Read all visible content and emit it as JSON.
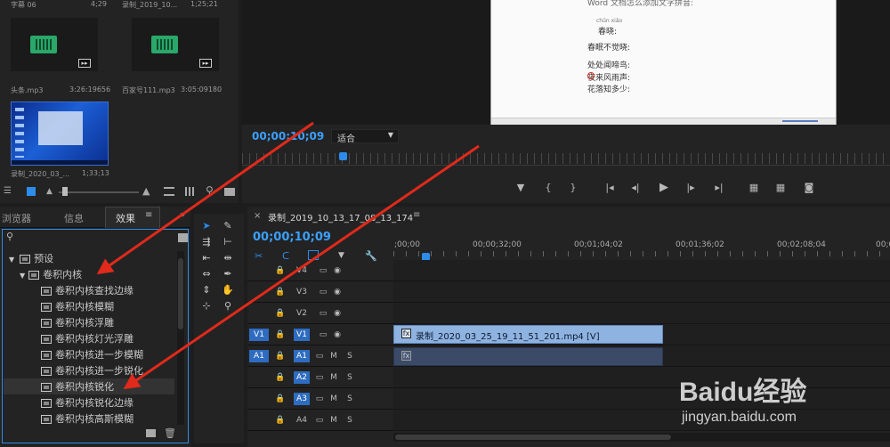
{
  "project": {
    "items": [
      {
        "name": "字幕 06",
        "duration": "4;29"
      },
      {
        "name": "录制_2019_10...",
        "duration": "1;25;21"
      },
      {
        "name": "头条.mp3",
        "duration": "3:26:19656"
      },
      {
        "name": "百家号111.mp3",
        "duration": "3:05:09180"
      },
      {
        "name": "录制_2020_03_...",
        "duration": "1;33;13"
      }
    ]
  },
  "program": {
    "doc_title": "Word 文档怎么添加文字拼音:",
    "doc_lines": [
      "chūn xiǎo",
      "春晓:",
      "春眠不觉晓:",
      "处处闻啼鸟:",
      "夜来风雨声:",
      "花落知多少:"
    ],
    "timecode": "00;00;10;09",
    "fit_label": "适合"
  },
  "panels": {
    "tabs": [
      "浏览器",
      "信息",
      "效果"
    ],
    "active_tab": "效果",
    "tree": [
      {
        "label": "预设",
        "level": 0
      },
      {
        "label": "卷积内核",
        "level": 1
      },
      {
        "label": "卷积内核查找边缘",
        "level": 2
      },
      {
        "label": "卷积内核模糊",
        "level": 2
      },
      {
        "label": "卷积内核浮雕",
        "level": 2
      },
      {
        "label": "卷积内核灯光浮雕",
        "level": 2
      },
      {
        "label": "卷积内核进一步模糊",
        "level": 2
      },
      {
        "label": "卷积内核进一步锐化",
        "level": 2
      },
      {
        "label": "卷积内核锐化",
        "level": 2
      },
      {
        "label": "卷积内核锐化边缘",
        "level": 2
      },
      {
        "label": "卷积内核高斯模糊",
        "level": 2
      }
    ]
  },
  "timeline": {
    "sequence_name": "录制_2019_10_13_17_08_13_174",
    "timecode": "00;00;10;09",
    "ruler": [
      ";00;00",
      "00;00;32;00",
      "00;01;04;02",
      "00;01;36;02",
      "00;02;08;04",
      "00;02"
    ],
    "tracks": [
      {
        "src": "",
        "name": "V4",
        "type": "video"
      },
      {
        "src": "",
        "name": "V3",
        "type": "video"
      },
      {
        "src": "",
        "name": "V2",
        "type": "video"
      },
      {
        "src": "V1",
        "name": "V1",
        "type": "video"
      },
      {
        "src": "A1",
        "name": "A1",
        "type": "audio"
      },
      {
        "src": "",
        "name": "A2",
        "type": "audio"
      },
      {
        "src": "",
        "name": "A3",
        "type": "audio"
      },
      {
        "src": "",
        "name": "A4",
        "type": "audio"
      }
    ],
    "video_clip": "录制_2020_03_25_19_11_51_201.mp4 [V]",
    "mute": "M",
    "solo": "S"
  },
  "watermark": {
    "brand": "Baidu经验",
    "url": "jingyan.baidu.com"
  },
  "colors": {
    "accent": "#2d8ceb",
    "clip_video": "#8fb3e0",
    "clip_audio": "#3b4a66",
    "annotation": "#e02a1b"
  }
}
